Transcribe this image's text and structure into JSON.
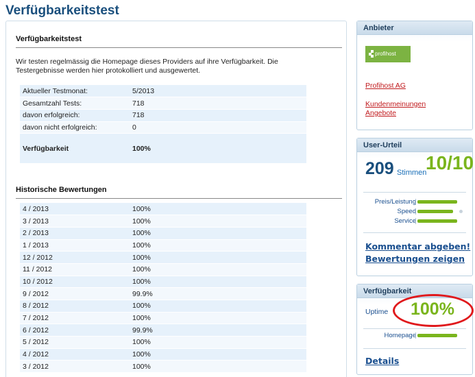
{
  "page_title": "Verfügbarkeitstest",
  "main": {
    "section_title": "Verfügbarkeitstest",
    "intro": "Wir testen regelmässig die Homepage dieses Providers auf ihre Verfügbarkeit. Die Testergebnisse werden hier protokolliert und ausgewertet.",
    "stats": [
      {
        "label": "Aktueller Testmonat:",
        "value": "5/2013"
      },
      {
        "label": "Gesamtzahl Tests:",
        "value": "718"
      },
      {
        "label": "davon erfolgreich:",
        "value": "718"
      },
      {
        "label": "davon nicht erfolgreich:",
        "value": "0"
      }
    ],
    "availability": {
      "label": "Verfügbarkeit",
      "value": "100%"
    },
    "history_title": "Historische Bewertungen",
    "history": [
      {
        "month": "4 / 2013",
        "value": "100%"
      },
      {
        "month": "3 / 2013",
        "value": "100%"
      },
      {
        "month": "2 / 2013",
        "value": "100%"
      },
      {
        "month": "1 / 2013",
        "value": "100%"
      },
      {
        "month": "12 / 2012",
        "value": "100%"
      },
      {
        "month": "11 / 2012",
        "value": "100%"
      },
      {
        "month": "10 / 2012",
        "value": "100%"
      },
      {
        "month": "9 / 2012",
        "value": "99.9%"
      },
      {
        "month": "8 / 2012",
        "value": "100%"
      },
      {
        "month": "7 / 2012",
        "value": "100%"
      },
      {
        "month": "6 / 2012",
        "value": "99.9%"
      },
      {
        "month": "5 / 2012",
        "value": "100%"
      },
      {
        "month": "4 / 2012",
        "value": "100%"
      },
      {
        "month": "3 / 2012",
        "value": "100%"
      }
    ]
  },
  "sidebar": {
    "provider": {
      "title": "Anbieter",
      "logo_text": "profihost",
      "name_link": "Profihost AG",
      "reviews_link": "Kundenmeinungen",
      "offers_link": "Angebote"
    },
    "user_rating": {
      "title": "User-Urteil",
      "votes": "209",
      "votes_label": "Stimmen",
      "score": "10/10",
      "ratings": [
        {
          "label": "Preis/Leistung",
          "fraction": 1.0
        },
        {
          "label": "Speed",
          "fraction": 0.9
        },
        {
          "label": "Service",
          "fraction": 1.0
        }
      ],
      "comment_link": "Kommentar abgeben!",
      "show_link": "Bewertungen zeigen"
    },
    "availability": {
      "title": "Verfügbarkeit",
      "uptime_label": "Uptime",
      "uptime_value": "100%",
      "homepage_label": "Homepage",
      "homepage_fraction": 1.0,
      "details_link": "Details"
    }
  },
  "colors": {
    "accent_green": "#7ab51d",
    "title_blue": "#1a4f7d",
    "link_red": "#c0191c",
    "highlight_circle": "#e0191c"
  }
}
